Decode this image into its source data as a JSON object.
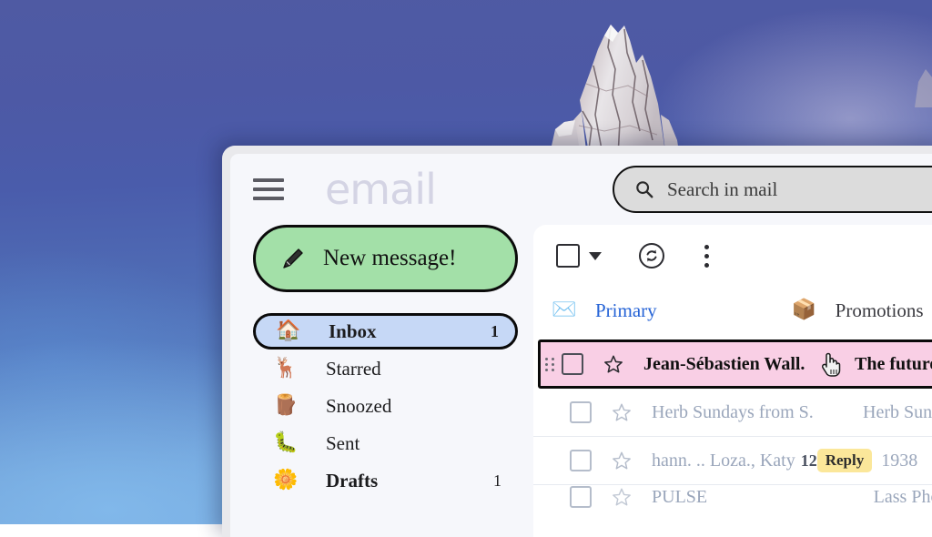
{
  "desktop": {
    "wallpaper_description": "blue-purple sky with snow-covered rocky mountain peak",
    "sky_color_top": "#4f5aa3",
    "sky_color_bottom": "#77aade",
    "rock_color": "#d9d4d6"
  },
  "window": {
    "bezel_color": "#e9e9ec",
    "surface_color": "#f6f7fb"
  },
  "header": {
    "menu_icon": "hamburger-icon",
    "logo_text": "email",
    "logo_color": "#d4d4e4"
  },
  "search": {
    "icon": "search-icon",
    "placeholder": "Search in mail",
    "value": "",
    "fill_color": "#dcdcdc"
  },
  "compose": {
    "icon": "pencil-icon",
    "label": "New message!",
    "color": "#a3e0a8"
  },
  "sidebar": {
    "items": [
      {
        "emoji": "🏠",
        "icon_name": "house-emoji",
        "label": "Inbox",
        "count": "1",
        "active": true,
        "bold": true
      },
      {
        "emoji": "🦌",
        "icon_name": "deer-emoji",
        "label": "Starred",
        "count": "",
        "active": false,
        "bold": false
      },
      {
        "emoji": "🪵",
        "icon_name": "wood-emoji",
        "label": "Snoozed",
        "count": "",
        "active": false,
        "bold": false
      },
      {
        "emoji": "🐛",
        "icon_name": "caterpillar-emoji",
        "label": "Sent",
        "count": "",
        "active": false,
        "bold": false
      },
      {
        "emoji": "🌼",
        "icon_name": "blossom-emoji",
        "label": "Drafts",
        "count": "1",
        "active": false,
        "bold": true
      }
    ],
    "active_bg": "#c6d8f6"
  },
  "toolbar": {
    "select_all_checkbox": "select-all-checkbox",
    "select_caret": "chevron-down-icon",
    "refresh_icon": "refresh-icon",
    "more_icon": "kebab-menu-icon"
  },
  "tabs": [
    {
      "emoji": "✉️",
      "icon_name": "envelope-emoji",
      "label": "Primary",
      "active": true
    },
    {
      "emoji": "📦",
      "icon_name": "package-emoji",
      "label": "Promotions",
      "active": false
    }
  ],
  "tab_indicator_color": "#2a5bd7",
  "mail_list": {
    "rows": [
      {
        "selected": true,
        "unread": true,
        "drag_handle": "drag-handle-icon",
        "checkbox": "row-checkbox",
        "star": "star-icon",
        "sender": "Jean-Sébastien Wall.",
        "count": "",
        "badge": "",
        "subject": "The future o",
        "cursor": "pointer-hand-cursor",
        "bg_color": "#f9cfe5"
      },
      {
        "selected": false,
        "unread": false,
        "checkbox": "row-checkbox",
        "star": "star-icon",
        "sender": "Herb Sundays from S.",
        "count": "",
        "badge": "",
        "subject": "Herb Sunday"
      },
      {
        "selected": false,
        "unread": false,
        "checkbox": "row-checkbox",
        "star": "star-icon",
        "sender": "hann. .. Loza., Katy",
        "count": "12",
        "badge": "Reply",
        "badge_color": "#fbe79a",
        "subject": "1938"
      },
      {
        "selected": false,
        "unread": false,
        "partial": true,
        "checkbox": "row-checkbox",
        "star": "star-icon",
        "sender": "PULSE",
        "count": "",
        "badge": "",
        "subject": "Lass  Phot"
      }
    ]
  }
}
